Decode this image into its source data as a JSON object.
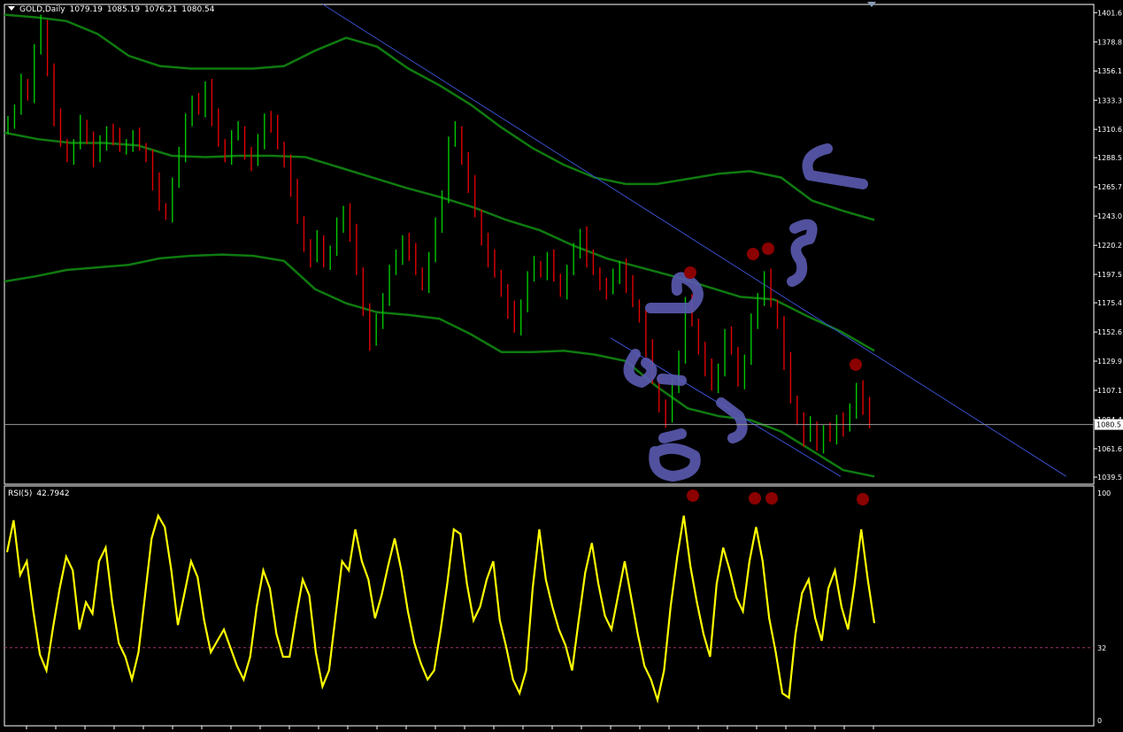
{
  "header": {
    "symbol": "GOLD,Daily",
    "open": "1079.19",
    "high": "1085.19",
    "low": "1076.21",
    "close": "1080.54"
  },
  "rsi_header": {
    "name": "RSI(5)",
    "value": "42.7942"
  },
  "colors": {
    "background": "#000000",
    "grid": "#ffffff",
    "bull_candle": "#00c800",
    "bear_candle": "#e00000",
    "ma_band": "#0f7a0f",
    "trendline": "#3a4fd0",
    "rsi_line": "#ffff00",
    "rsi_level": "#a0326e",
    "marker": "#8b0000",
    "annotation": "#5a5ab0",
    "price_label_bg": "#ffffff"
  },
  "chart_data": [
    {
      "type": "candlestick",
      "title": "GOLD,Daily",
      "y_ticks": [
        "1401.6",
        "1378.8",
        "1356.1",
        "1333.3",
        "1310.6",
        "1288.5",
        "1265.7",
        "1243.0",
        "1220.2",
        "1197.5",
        "1175.4",
        "1152.6",
        "1129.9",
        "1107.1",
        "1084.4",
        "1061.6",
        "1039.5"
      ],
      "ylim": [
        1034,
        1408
      ],
      "current_price": "1080.5",
      "grid": false,
      "series": [
        {
          "kind": "candles",
          "values": [
            1318,
            1325,
            1347,
            1338,
            1372,
            1393,
            1357,
            1320,
            1300,
            1290,
            1298,
            1315,
            1304,
            1288,
            1299,
            1310,
            1305,
            1296,
            1300,
            1305,
            1297,
            1290,
            1270,
            1250,
            1245,
            1268,
            1290,
            1320,
            1332,
            1325,
            1345,
            1320,
            1300,
            1290,
            1305,
            1310,
            1292,
            1285,
            1300,
            1320,
            1315,
            1298,
            1286,
            1265,
            1240,
            1220,
            1210,
            1225,
            1208,
            1215,
            1235,
            1248,
            1230,
            1200,
            1170,
            1145,
            1160,
            1180,
            1200,
            1210,
            1225,
            1215,
            1200,
            1190,
            1210,
            1235,
            1260,
            1300,
            1310,
            1288,
            1268,
            1245,
            1225,
            1210,
            1198,
            1185,
            1170,
            1155,
            1175,
            1195,
            1205,
            1200,
            1210,
            1195,
            1185,
            1200,
            1215,
            1230,
            1210,
            1200,
            1190,
            1185,
            1195,
            1205,
            1190,
            1175,
            1165,
            1140,
            1115,
            1095,
            1085,
            1110,
            1135,
            1175,
            1160,
            1140,
            1125,
            1110,
            1125,
            1150,
            1138,
            1115,
            1130,
            1160,
            1180,
            1195,
            1175,
            1160,
            1130,
            1100,
            1085,
            1070,
            1080,
            1065,
            1075,
            1070,
            1085,
            1078,
            1090,
            1110,
            1095,
            1080.54
          ]
        },
        {
          "kind": "ma_upper",
          "values": [
            1400,
            1398,
            1395,
            1385,
            1368,
            1360,
            1358,
            1358,
            1358,
            1360,
            1372,
            1382,
            1375,
            1358,
            1345,
            1330,
            1312,
            1296,
            1283,
            1273,
            1268,
            1268,
            1272,
            1276,
            1278,
            1273,
            1255,
            1247,
            1240
          ]
        },
        {
          "kind": "ma_middle",
          "values": [
            1308,
            1303,
            1300,
            1300,
            1298,
            1290,
            1289,
            1290,
            1290,
            1289,
            1281,
            1273,
            1265,
            1258,
            1250,
            1240,
            1232,
            1220,
            1210,
            1203,
            1196,
            1188,
            1180,
            1178,
            1165,
            1153,
            1138
          ]
        },
        {
          "kind": "ma_lower",
          "values": [
            1192,
            1196,
            1201,
            1203,
            1205,
            1210,
            1212,
            1213,
            1212,
            1208,
            1186,
            1175,
            1168,
            1166,
            1163,
            1151,
            1137,
            1137,
            1138,
            1135,
            1130,
            1110,
            1093,
            1087,
            1084,
            1075,
            1060,
            1045,
            1040
          ]
        },
        {
          "kind": "trendline",
          "values": [
            1408,
            1040
          ]
        }
      ]
    },
    {
      "type": "line",
      "title": "RSI(5) 42.7942",
      "y_ticks": [
        "100",
        "32",
        "0"
      ],
      "ylim": [
        0,
        100
      ],
      "levels": [
        32
      ],
      "series": [
        {
          "name": "RSI(5)",
          "values": [
            74,
            88,
            64,
            70,
            48,
            29,
            22,
            41,
            58,
            72,
            66,
            40,
            52,
            47,
            70,
            76,
            52,
            34,
            28,
            18,
            30,
            55,
            80,
            90,
            85,
            66,
            42,
            56,
            70,
            63,
            44,
            30,
            35,
            40,
            32,
            24,
            18,
            28,
            50,
            66,
            58,
            38,
            28,
            28,
            46,
            62,
            55,
            30,
            15,
            22,
            46,
            70,
            66,
            84,
            70,
            62,
            45,
            55,
            68,
            80,
            66,
            48,
            34,
            25,
            18,
            22,
            40,
            60,
            84,
            82,
            60,
            44,
            50,
            62,
            70,
            44,
            32,
            18,
            12,
            22,
            58,
            84,
            62,
            50,
            40,
            33,
            22,
            44,
            65,
            78,
            60,
            46,
            40,
            55,
            70,
            54,
            38,
            24,
            18,
            9,
            22,
            50,
            72,
            90,
            68,
            52,
            38,
            28,
            60,
            76,
            66,
            54,
            48,
            70,
            85,
            70,
            45,
            30,
            12,
            10,
            38,
            56,
            62,
            45,
            35,
            58,
            66,
            50,
            40,
            60,
            84,
            62,
            42.79
          ]
        }
      ]
    }
  ]
}
